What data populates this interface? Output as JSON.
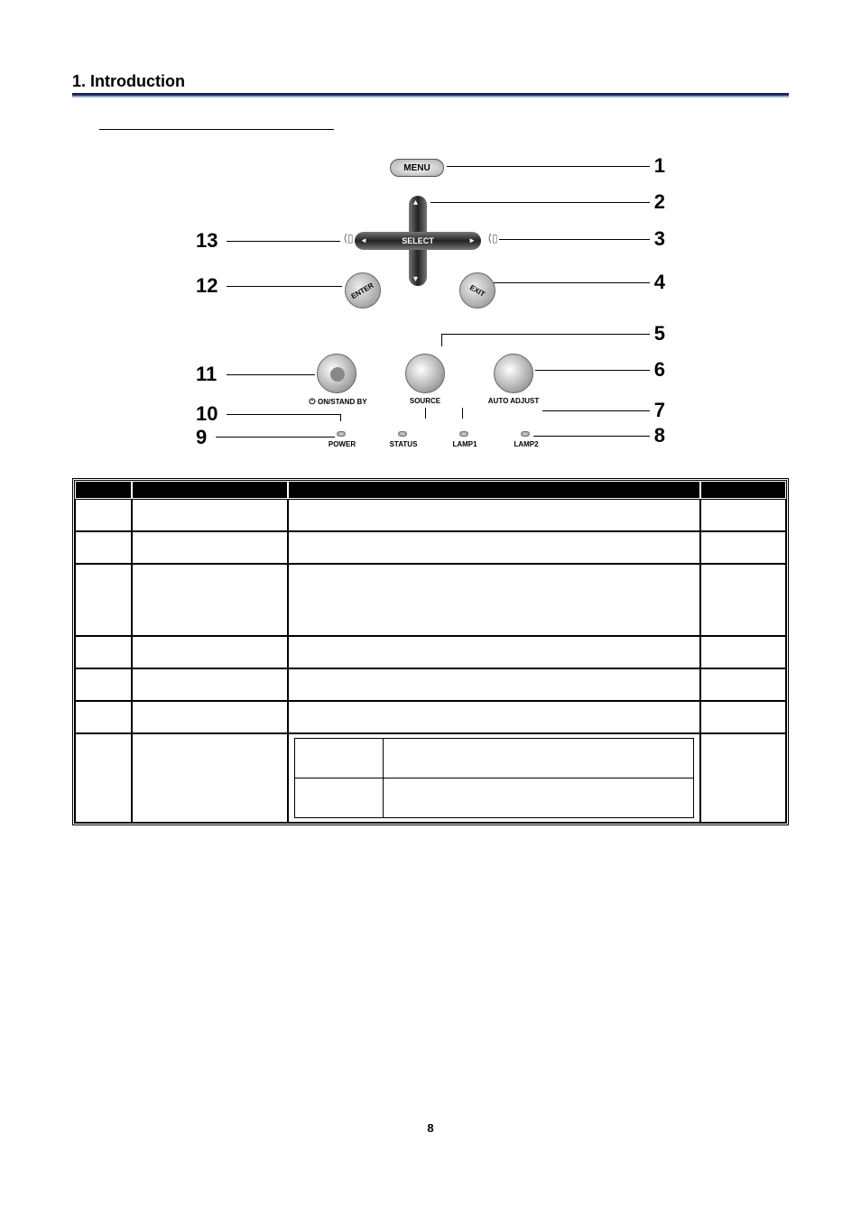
{
  "section_title": "1. Introduction",
  "diagram_labels": {
    "menu": "MENU",
    "select": "SELECT",
    "enter": "ENTER",
    "exit": "EXIT",
    "on_standby": "ON/STAND BY",
    "source": "SOURCE",
    "auto_adjust": "AUTO ADJUST",
    "led_power": "POWER",
    "led_status": "STATUS",
    "led_lamp1": "LAMP1",
    "led_lamp2": "LAMP2"
  },
  "callout_numbers": {
    "n1": "1",
    "n2": "2",
    "n3": "3",
    "n4": "4",
    "n5": "5",
    "n6": "6",
    "n7": "7",
    "n8": "8",
    "n9": "9",
    "n10": "10",
    "n11": "11",
    "n12": "12",
    "n13": "13"
  },
  "table": {
    "headers": {
      "item": "",
      "label": "",
      "description": "",
      "page": ""
    },
    "rows": [
      {
        "item": "",
        "label": "",
        "description": "",
        "page": "",
        "h": "h40"
      },
      {
        "item": "",
        "label": "",
        "description": "",
        "page": "",
        "h": "h40"
      },
      {
        "item": "",
        "label": "",
        "description": "",
        "page": "",
        "h": "h80"
      },
      {
        "item": "",
        "label": "",
        "description": "",
        "page": "",
        "h": "h40"
      },
      {
        "item": "",
        "label": "",
        "description": "",
        "page": "",
        "h": "h40"
      },
      {
        "item": "",
        "label": "",
        "description": "",
        "page": "",
        "h": "h40"
      }
    ],
    "status_row": {
      "item": "",
      "label": "",
      "page": "",
      "sub1": {
        "left": "",
        "right": ""
      },
      "sub2": {
        "left": "",
        "right": ""
      }
    }
  },
  "page_number": "8"
}
